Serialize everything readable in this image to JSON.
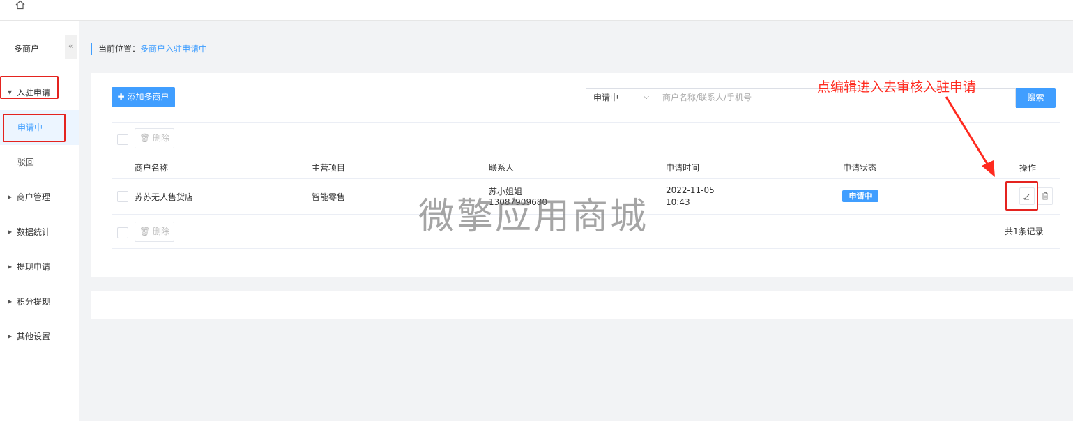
{
  "topbar": {
    "home_icon": "home-icon"
  },
  "sidebar": {
    "title": "多商户",
    "collapse_glyph": "«",
    "groups": [
      {
        "label": "入驻申请",
        "expanded": true,
        "children": [
          {
            "label": "申请中",
            "active": true
          },
          {
            "label": "驳回",
            "active": false
          }
        ]
      },
      {
        "label": "商户管理"
      },
      {
        "label": "数据统计"
      },
      {
        "label": "提现申请"
      },
      {
        "label": "积分提现"
      },
      {
        "label": "其他设置"
      }
    ]
  },
  "breadcrumb": {
    "prefix": "当前位置：",
    "current": "多商户入驻申请中"
  },
  "toolbar": {
    "add_label": "添加多商户",
    "status_select": "申请中",
    "search_placeholder": "商户名称/联系人/手机号",
    "search_label": "搜索"
  },
  "table": {
    "delete_label": "删除",
    "columns": [
      "商户名称",
      "主营项目",
      "联系人",
      "申请时间",
      "申请状态",
      "操作"
    ],
    "rows": [
      {
        "name": "苏苏无人售货店",
        "business": "智能零售",
        "contact_name": "苏小姐姐",
        "contact_phone": "13087909680",
        "date": "2022-11-05",
        "time": "10:43",
        "status": "申请中"
      }
    ],
    "total": "共1条记录"
  },
  "overlay": {
    "watermark": "微擎应用商城",
    "annotation": "点编辑进入去审核入驻申请"
  },
  "colors": {
    "accent": "#409eff",
    "annotation_red": "#e4231f"
  }
}
